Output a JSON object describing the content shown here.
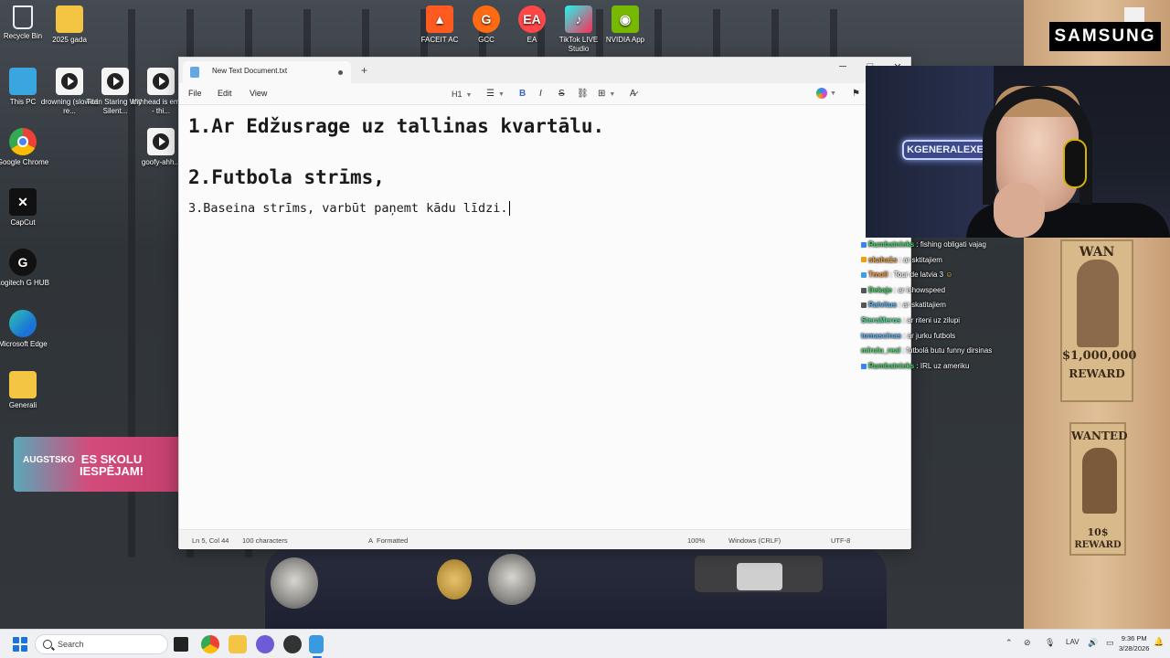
{
  "desktop": {
    "icons": [
      {
        "label": "Recycle Bin",
        "icon": "recycle-bin-icon"
      },
      {
        "label": "2025 gada",
        "icon": "folder-icon"
      },
      {
        "label": "This PC",
        "icon": "monitor-icon"
      },
      {
        "label": "drowning (slowed re...",
        "icon": "video-file-icon"
      },
      {
        "label": "Titan Staring With Silent...",
        "icon": "video-file-icon"
      },
      {
        "label": "my head is empty - thi...",
        "icon": "video-file-icon"
      },
      {
        "label": "Google Chrome",
        "icon": "chrome-icon"
      },
      {
        "label": "goofy-ahh...",
        "icon": "video-file-icon"
      },
      {
        "label": "CapCut",
        "icon": "capcut-icon"
      },
      {
        "label": "Logitech G HUB",
        "icon": "logitech-icon"
      },
      {
        "label": "Microsoft Edge",
        "icon": "edge-icon"
      },
      {
        "label": "Generali",
        "icon": "folder-icon"
      },
      {
        "label": "FACEIT AC",
        "icon": "faceit-icon"
      },
      {
        "label": "GCC",
        "icon": "gcc-icon"
      },
      {
        "label": "EA",
        "icon": "ea-icon"
      },
      {
        "label": "TikTok LIVE Studio",
        "icon": "tiktok-icon"
      },
      {
        "label": "NVIDIA App",
        "icon": "nvidia-icon"
      }
    ]
  },
  "banner": {
    "line1": "AUGSTSKO",
    "line2a": "ES SKOLU",
    "line2b": "IESPĒJAM!"
  },
  "overlay": {
    "brand": "SAMSUNG",
    "neon_sign": "KGENERALEXE"
  },
  "notepad": {
    "tab_title": "New Text Document.txt",
    "menu": [
      "File",
      "Edit",
      "View"
    ],
    "heading_style": "H1",
    "lines": [
      "1.Ar Edžusrage uz tallinas kvartālu.",
      "2.Futbola strīms,",
      "3.Baseina strīms, varbūt paņemt kādu līdzi."
    ],
    "status": {
      "position": "Ln 5, Col 44",
      "characters": "100 characters",
      "mode": "Formatted",
      "zoom": "100%",
      "line_endings": "Windows (CRLF)",
      "encoding": "UTF-8"
    }
  },
  "chat": [
    {
      "user": "Rumbatnieks",
      "color": "#4ad36b",
      "msg": "fishing obligati vajag"
    },
    {
      "user": "skaha1s",
      "color": "#e8a03a",
      "msg": "ar sktitajiem"
    },
    {
      "user": "Tmoll",
      "color": "#ff9a3d",
      "msg": "Tour de latvia 3"
    },
    {
      "user": "Dekaje",
      "color": "#49d36e",
      "msg": "ar ishowspeed"
    },
    {
      "user": "Raivitus",
      "color": "#5fb6f2",
      "msg": "ar skatitajiem"
    },
    {
      "user": "SteraMeros",
      "color": "#55e39a",
      "msg": "ar riteni uz zilupi"
    },
    {
      "user": "tomascinas",
      "color": "#62b8ff",
      "msg": "ar jurku futbols"
    },
    {
      "user": "mīrulu_real",
      "color": "#5ee07b",
      "msg": "futbolā butu funny dirsinas"
    },
    {
      "user": "Rumbatnieks",
      "color": "#4ad36b",
      "msg": "IRL uz ameriku"
    }
  ],
  "posters": [
    {
      "top": "WAN",
      "amount": "$1,000,000",
      "reward": "REWARD"
    },
    {
      "top": "WANTED",
      "amount": "10$",
      "reward": "REWARD"
    }
  ],
  "taskbar": {
    "search_placeholder": "Search",
    "language": "LAV",
    "time": "9:36 PM",
    "date": "3/28/2026"
  }
}
